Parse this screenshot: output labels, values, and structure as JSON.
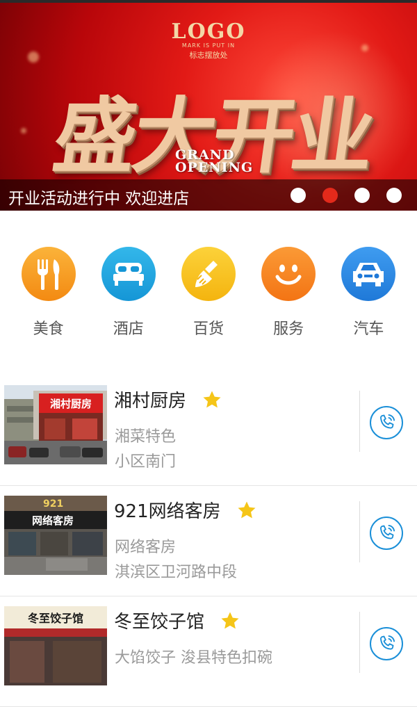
{
  "banner": {
    "logo": "LOGO",
    "logo_sub": "MARK IS PUT IN",
    "logo_sub_cn": "标志摆放处",
    "headline": "盛大开业",
    "grand_line1": "GRAND",
    "grand_line2": "OPENING",
    "caption": "开业活动进行中 欢迎进店",
    "active_slide": 2,
    "slide_count": 4,
    "accent_color": "#e32a1b"
  },
  "categories": [
    {
      "label": "美食",
      "icon": "utensils-icon",
      "color": "#f8a01c"
    },
    {
      "label": "酒店",
      "icon": "bed-icon",
      "color": "#22a7e0"
    },
    {
      "label": "百货",
      "icon": "brush-icon",
      "color": "#f7c21a"
    },
    {
      "label": "服务",
      "icon": "smile-icon",
      "color": "#f7861c"
    },
    {
      "label": "汽车",
      "icon": "car-icon",
      "color": "#2c8ce6"
    }
  ],
  "listings": [
    {
      "name": "湘村厨房",
      "sub1": "湘菜特色",
      "sub2": "小区南门",
      "sign": "湘村厨房"
    },
    {
      "name": "921网络客房",
      "sub1": "网络客房",
      "sub2": "淇滨区卫河路中段",
      "sign": "网络客房"
    },
    {
      "name": "冬至饺子馆",
      "sub1": "大馅饺子 浚县特色扣碗",
      "sub2": "",
      "sign": "冬至饺子馆"
    }
  ],
  "colors": {
    "star": "#f5c518",
    "phone": "#1a8fd8"
  }
}
